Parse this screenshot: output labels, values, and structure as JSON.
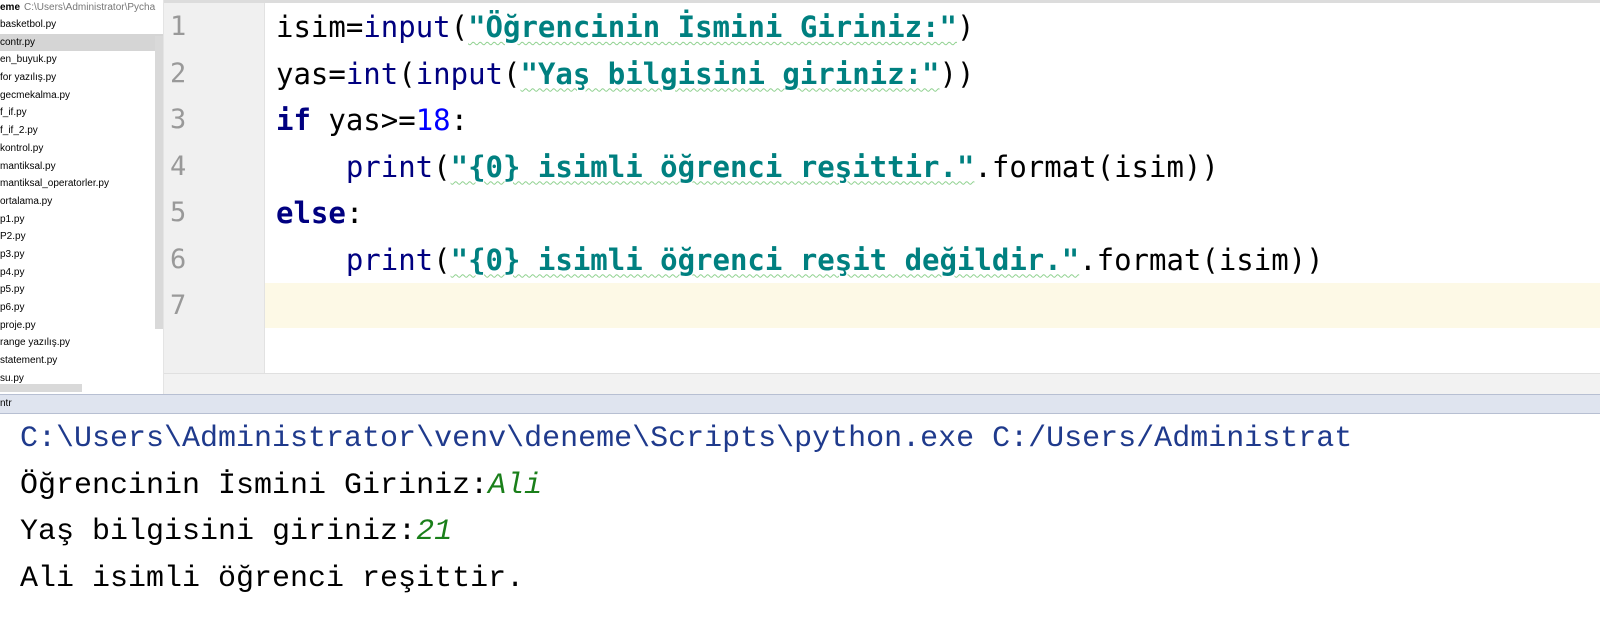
{
  "project": {
    "root_name": "eme",
    "root_path": "C:\\Users\\Administrator\\Pycha",
    "files": [
      {
        "name": "basketbol.py",
        "selected": false
      },
      {
        "name": "contr.py",
        "selected": true
      },
      {
        "name": "en_buyuk.py",
        "selected": false
      },
      {
        "name": "for yazılış.py",
        "selected": false
      },
      {
        "name": "gecmekalma.py",
        "selected": false
      },
      {
        "name": "f_if.py",
        "selected": false
      },
      {
        "name": "f_if_2.py",
        "selected": false
      },
      {
        "name": "kontrol.py",
        "selected": false
      },
      {
        "name": "mantiksal.py",
        "selected": false
      },
      {
        "name": "mantiksal_operatorler.py",
        "selected": false
      },
      {
        "name": "ortalama.py",
        "selected": false
      },
      {
        "name": "p1.py",
        "selected": false
      },
      {
        "name": "P2.py",
        "selected": false
      },
      {
        "name": "p3.py",
        "selected": false
      },
      {
        "name": "p4.py",
        "selected": false
      },
      {
        "name": "p5.py",
        "selected": false
      },
      {
        "name": "p6.py",
        "selected": false
      },
      {
        "name": "proje.py",
        "selected": false
      },
      {
        "name": "range yazılış.py",
        "selected": false
      },
      {
        "name": "statement.py",
        "selected": false
      },
      {
        "name": "su.py",
        "selected": false
      }
    ]
  },
  "editor": {
    "line_numbers": [
      "1",
      "2",
      "3",
      "4",
      "5",
      "6",
      "7"
    ],
    "caret_line": 7,
    "lines": [
      [
        {
          "t": "isim=",
          "c": "plain"
        },
        {
          "t": "input",
          "c": "bi"
        },
        {
          "t": "(",
          "c": "plain"
        },
        {
          "t": "\"Öğrencinin İsmini Giriniz:\"",
          "c": "str"
        },
        {
          "t": ")",
          "c": "plain"
        }
      ],
      [
        {
          "t": "yas=",
          "c": "plain"
        },
        {
          "t": "int",
          "c": "bi"
        },
        {
          "t": "(",
          "c": "plain"
        },
        {
          "t": "input",
          "c": "bi"
        },
        {
          "t": "(",
          "c": "plain"
        },
        {
          "t": "\"Yaş bilgisini giriniz:\"",
          "c": "str"
        },
        {
          "t": "))",
          "c": "plain"
        }
      ],
      [
        {
          "t": "if",
          "c": "kw"
        },
        {
          "t": " yas>=",
          "c": "plain"
        },
        {
          "t": "18",
          "c": "num"
        },
        {
          "t": ":",
          "c": "plain"
        }
      ],
      [
        {
          "t": "    ",
          "c": "plain"
        },
        {
          "t": "print",
          "c": "bi"
        },
        {
          "t": "(",
          "c": "plain"
        },
        {
          "t": "\"{0} isimli öğrenci reşittir.\"",
          "c": "str"
        },
        {
          "t": ".format(isim))",
          "c": "plain"
        }
      ],
      [
        {
          "t": "else",
          "c": "kw"
        },
        {
          "t": ":",
          "c": "plain"
        }
      ],
      [
        {
          "t": "    ",
          "c": "plain"
        },
        {
          "t": "print",
          "c": "bi"
        },
        {
          "t": "(",
          "c": "plain"
        },
        {
          "t": "\"{0} isimli öğrenci reşit değildir.\"",
          "c": "str"
        },
        {
          "t": ".format(isim))",
          "c": "plain"
        }
      ],
      []
    ]
  },
  "run_panel": {
    "tab_label": "ntr",
    "console_lines": [
      [
        {
          "t": "C:\\Users\\Administrator\\venv\\deneme\\Scripts\\python.exe C:/Users/Administrat",
          "c": "path-line"
        }
      ],
      [
        {
          "t": "Öğrencinin İsmini Giriniz:",
          "c": "out"
        },
        {
          "t": "Ali",
          "c": "inp"
        }
      ],
      [
        {
          "t": "Yaş bilgisini giriniz:",
          "c": "out"
        },
        {
          "t": "21",
          "c": "inp"
        }
      ],
      [
        {
          "t": "Ali isimli öğrenci reşittir.",
          "c": "out"
        }
      ]
    ]
  },
  "colors": {
    "keyword": "#000080",
    "string": "#008080",
    "number": "#0000ff",
    "console_path": "#1f3a8c",
    "console_input": "#1a7f1a",
    "caret_row": "#fdf9e6"
  }
}
